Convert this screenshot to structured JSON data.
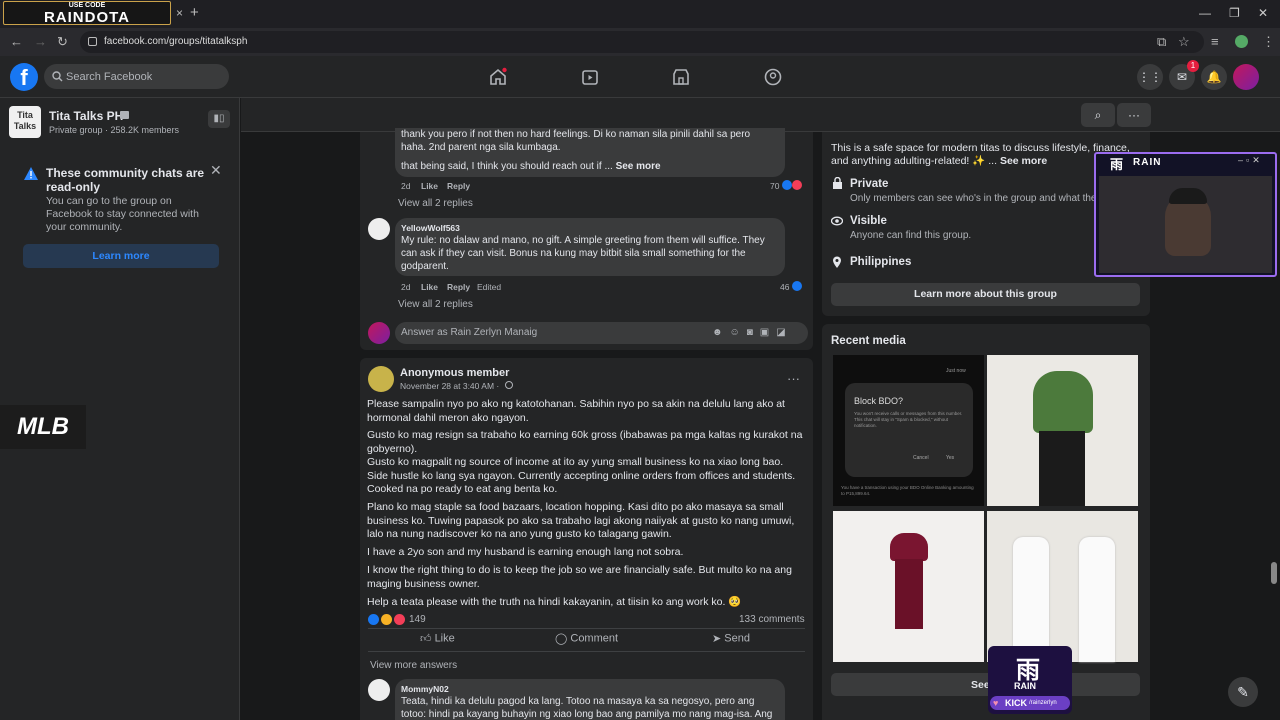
{
  "browser": {
    "promo_small": "USE CODE",
    "promo_big": "RAINDOTA",
    "url": "facebook.com/groups/titatalksph",
    "new_tab": "+",
    "close_tab": "×"
  },
  "fb": {
    "search_placeholder": "Search Facebook",
    "notif_count": "1"
  },
  "group": {
    "logo_text": "Tita Talks",
    "title": "Tita Talks PH",
    "meta": "Private group · 258.2K members"
  },
  "chats_notice": {
    "title": "These community chats are read-only",
    "body": "You can go to the group on Facebook to stay connected with your community.",
    "button": "Learn more"
  },
  "stream": {
    "mlb_logo": "MLB"
  },
  "thread": {
    "reply1": {
      "line1": "thank you pero if not then no hard feelings. Di ko naman sila pinili dahil sa pero haha. 2nd parent nga sila kumbaga.",
      "line2": "that being said, I think you should reach out if ...",
      "see_more": "See more",
      "time": "2d",
      "like": "Like",
      "reply": "Reply",
      "reactions": "70"
    },
    "view_replies_1": "View all 2 replies",
    "reply2": {
      "author": "YellowWolf563",
      "text": "My rule: no dalaw and mano, no gift. A simple greeting from them will suffice. They can ask if they can visit. Bonus na kung may bitbit sila small something for the godparent.",
      "time": "2d",
      "like": "Like",
      "reply": "Reply",
      "edited": "Edited",
      "reactions": "46"
    },
    "view_replies_2": "View all 2 replies",
    "answer_placeholder": "Answer as Rain Zerlyn Manaig"
  },
  "post": {
    "author": "Anonymous member",
    "date": "November 28 at 3:40 AM ·",
    "paragraphs": [
      "Please sampalin nyo po ako ng katotohanan. Sabihin nyo po sa akin na delulu lang ako at hormonal dahil meron ako ngayon.",
      "Gusto ko mag resign sa trabaho ko earning 60k gross (ibabawas pa mga kaltas ng kurakot na gobyerno).",
      "Gusto ko magpalit ng source of income at ito ay yung small business ko na xiao long bao. Side hustle ko lang sya ngayon. Currently accepting online orders from offices and students. Cooked na po ready to eat ang benta ko.",
      "Plano ko mag staple sa food bazaars, location hopping. Kasi dito po ako masaya sa small business ko. Tuwing papasok po ako sa trabaho lagi akong naiiyak at gusto ko nang umuwi, lalo na nung nadiscover ko na ano yung gusto ko talagang gawin.",
      "I have a 2yo son and my husband is earning enough lang not sobra.",
      "I know the right thing to do is to keep the job so we are financially safe. But multo ko na ang maging business owner.",
      "Help a teata please with the truth na hindi kakayanin, at tiisin ko ang work ko. 🥺"
    ],
    "reactions": "149",
    "comments": "133 comments",
    "like": "Like",
    "comment": "Comment",
    "send": "Send",
    "view_more": "View more answers"
  },
  "reply3": {
    "author": "MommyN02",
    "text": "Teata, hindi ka delulu pagod ka lang. Totoo na masaya ka sa negosyo, pero ang totoo: hindi pa kayang buhayin ng xiao long bao ang pamilya mo nang mag-isa. Ang"
  },
  "about": {
    "description": "This is a safe space for modern titas to discuss lifestyle, finance, and anything adulting-related! ✨ ...",
    "see_more": "See more",
    "private_title": "Private",
    "private_sub": "Only members can see who's in the group and what the",
    "visible_title": "Visible",
    "visible_sub": "Anyone can find this group.",
    "location": "Philippines",
    "button": "Learn more about this group"
  },
  "media": {
    "title": "Recent media",
    "thumb1_title": "Block BDO?",
    "thumb1_body": "You won't receive calls or messages from this number. This chat will stay in \"Spam & blocked,\" without notification.",
    "thumb1_cancel": "Cancel",
    "thumb1_yes": "Yes",
    "thumb1_footer": "You have a transaction using your BDO Online Banking amounting to P15,899.64.",
    "thumb1_time": "Just now",
    "see_all": "See"
  },
  "overlay": {
    "logo": "雨",
    "brand": "RAIN"
  },
  "kick": {
    "logo": "雨",
    "brand": "RAIN",
    "label": "KICK",
    "handle": "/rainzerlyn"
  },
  "colors": {
    "accent": "#1877f2",
    "link": "#2d88ff",
    "overlay_border": "#9b6cf0"
  }
}
